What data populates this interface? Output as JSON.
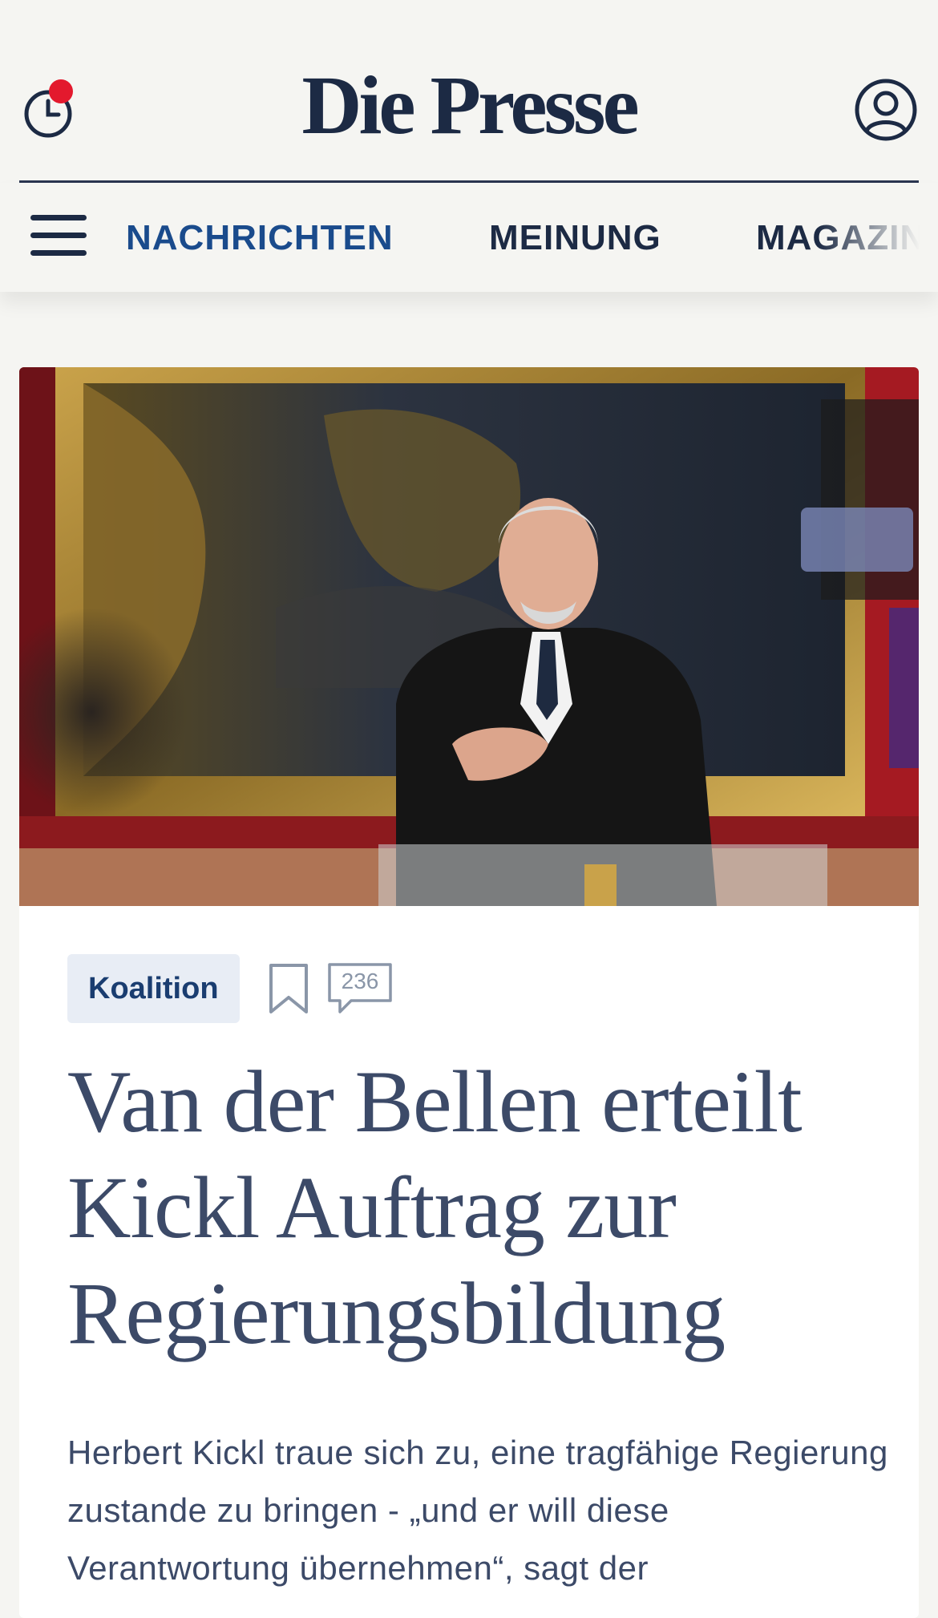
{
  "header": {
    "logo": "Die Presse",
    "history_icon": "clock-icon",
    "notification_dot_color": "#e3192d",
    "account_icon": "user-account-icon"
  },
  "nav": {
    "menu_icon": "hamburger-menu-icon",
    "items": [
      {
        "label": "NACHRICHTEN",
        "active": true
      },
      {
        "label": "MEINUNG",
        "active": false
      },
      {
        "label": "MAGAZIN",
        "active": false
      }
    ],
    "active_color": "#1a4b8c"
  },
  "article": {
    "image_description_icon": "photo-van-der-bellen",
    "topic": "Koalition",
    "bookmark_icon": "bookmark-icon",
    "comment_icon": "comment-bubble-icon",
    "comment_count": "236",
    "headline": "Van der Bellen erteilt Kickl Auftrag zur Regierungsbildung",
    "lead": "Herbert Kickl traue sich zu, eine tragfähige Regierung zustande zu bringen - „und er will diese Verantwortung übernehmen“, sagt der"
  },
  "colors": {
    "background": "#f5f5f2",
    "brand_navy": "#1c2a44",
    "headline": "#3c4a68",
    "tag_bg": "#e8edf5"
  }
}
